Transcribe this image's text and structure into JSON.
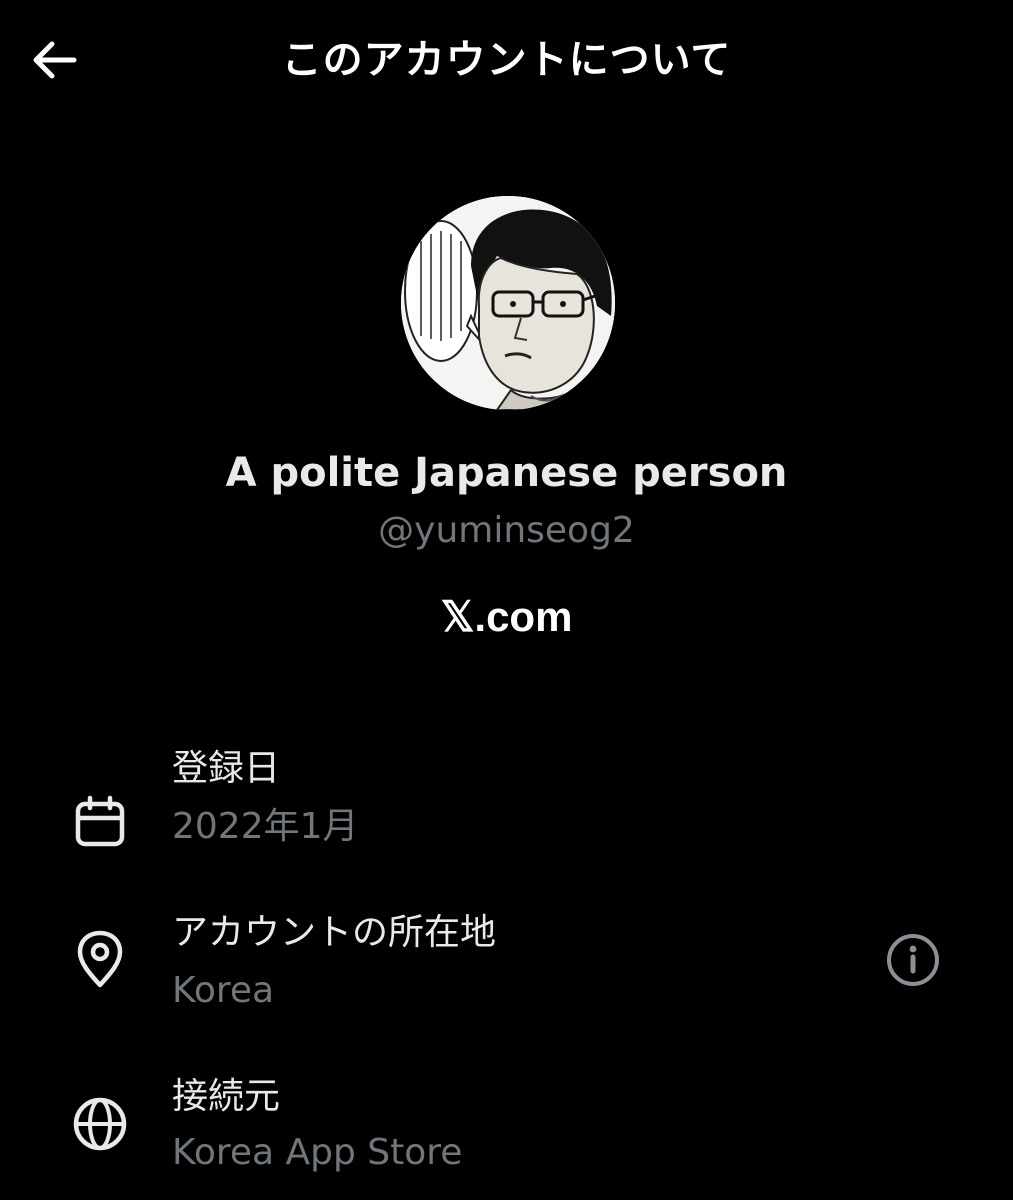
{
  "header": {
    "title": "このアカウントについて",
    "back_icon": "arrow-left-icon"
  },
  "profile": {
    "display_name": "A polite Japanese person",
    "handle": "@yuminseog2",
    "platform": "𝕏.com",
    "avatar_icon": "manga-portrait-avatar"
  },
  "details": [
    {
      "icon": "calendar-icon",
      "label": "登録日",
      "value": "2022年1月"
    },
    {
      "icon": "location-pin-icon",
      "label": "アカウントの所在地",
      "value": "Korea",
      "action_icon": "info-icon"
    },
    {
      "icon": "globe-icon",
      "label": "接続元",
      "value": "Korea App Store"
    }
  ],
  "colors": {
    "background": "#000000",
    "primary_text": "#e7e9ea",
    "secondary_text": "#71767b",
    "icon": "#e7e9ea"
  }
}
